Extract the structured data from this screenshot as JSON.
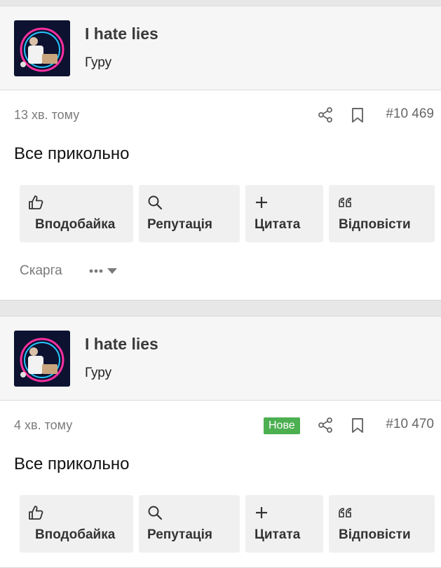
{
  "posts": [
    {
      "author": "I hate lies",
      "rank": "Гуру",
      "time": "13 хв. тому",
      "badge": "",
      "post_number": "#10 469",
      "content": "Все прикольно",
      "actions": {
        "like": "Вподобайка",
        "reputation": "Репутація",
        "quote": "Цитата",
        "reply": "Відповісти"
      },
      "report": "Скарга"
    },
    {
      "author": "I hate lies",
      "rank": "Гуру",
      "time": "4 хв. тому",
      "badge": "Нове",
      "post_number": "#10 470",
      "content": "Все прикольно",
      "actions": {
        "like": "Вподобайка",
        "reputation": "Репутація",
        "quote": "Цитата",
        "reply": "Відповісти"
      }
    }
  ],
  "colors": {
    "badge_new": "#4caf50",
    "page_bg": "#e7e7e7",
    "button_bg": "#f0f0f0"
  },
  "icons": [
    "avatar-image",
    "share-icon",
    "bookmark-icon",
    "thumbs-up-icon",
    "search-icon",
    "plus-icon",
    "quote-icon",
    "more-dots-icon",
    "chevron-down-icon"
  ]
}
